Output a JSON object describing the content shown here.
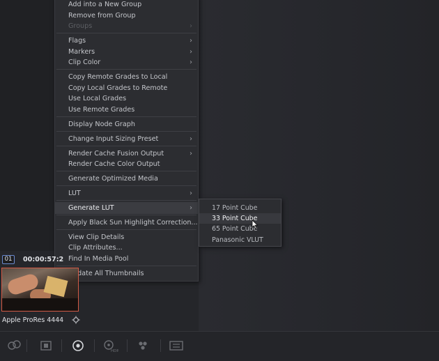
{
  "context_menu": {
    "items": [
      {
        "label": "Add into a New Group"
      },
      {
        "label": "Remove from Group"
      },
      {
        "label": "Groups"
      },
      {
        "label": "Flags"
      },
      {
        "label": "Markers"
      },
      {
        "label": "Clip Color"
      },
      {
        "label": "Copy Remote Grades to Local"
      },
      {
        "label": "Copy Local Grades to Remote"
      },
      {
        "label": "Use Local Grades"
      },
      {
        "label": "Use Remote Grades"
      },
      {
        "label": "Display Node Graph"
      },
      {
        "label": "Change Input Sizing Preset"
      },
      {
        "label": "Render Cache Fusion Output"
      },
      {
        "label": "Render Cache Color Output"
      },
      {
        "label": "Generate Optimized Media"
      },
      {
        "label": "LUT"
      },
      {
        "label": "Generate LUT"
      },
      {
        "label": "Apply Black Sun Highlight Correction..."
      },
      {
        "label": "View Clip Details"
      },
      {
        "label": "Clip Attributes..."
      },
      {
        "label": "Find In Media Pool"
      },
      {
        "label": "Update All Thumbnails"
      }
    ],
    "submenu_arrow": "›"
  },
  "generate_lut_submenu": {
    "items": [
      {
        "label": "17 Point Cube"
      },
      {
        "label": "33 Point Cube"
      },
      {
        "label": "65 Point Cube"
      },
      {
        "label": "Panasonic VLUT"
      }
    ]
  },
  "clip": {
    "number": "01",
    "timecode": "00:00:57:2",
    "name": "Apple ProRes 4444"
  },
  "toolbar": {
    "icons": [
      "clips-icon",
      "lut-browser-icon",
      "color-wheels-icon",
      "hdr-icon",
      "rgb-mixer-icon",
      "motion-effects-icon"
    ]
  },
  "colors": {
    "background": "#25262a",
    "menu_bg": "#2c2d31",
    "clip_selection": "#d35a45",
    "clip_number_border": "#6b8bd0"
  }
}
